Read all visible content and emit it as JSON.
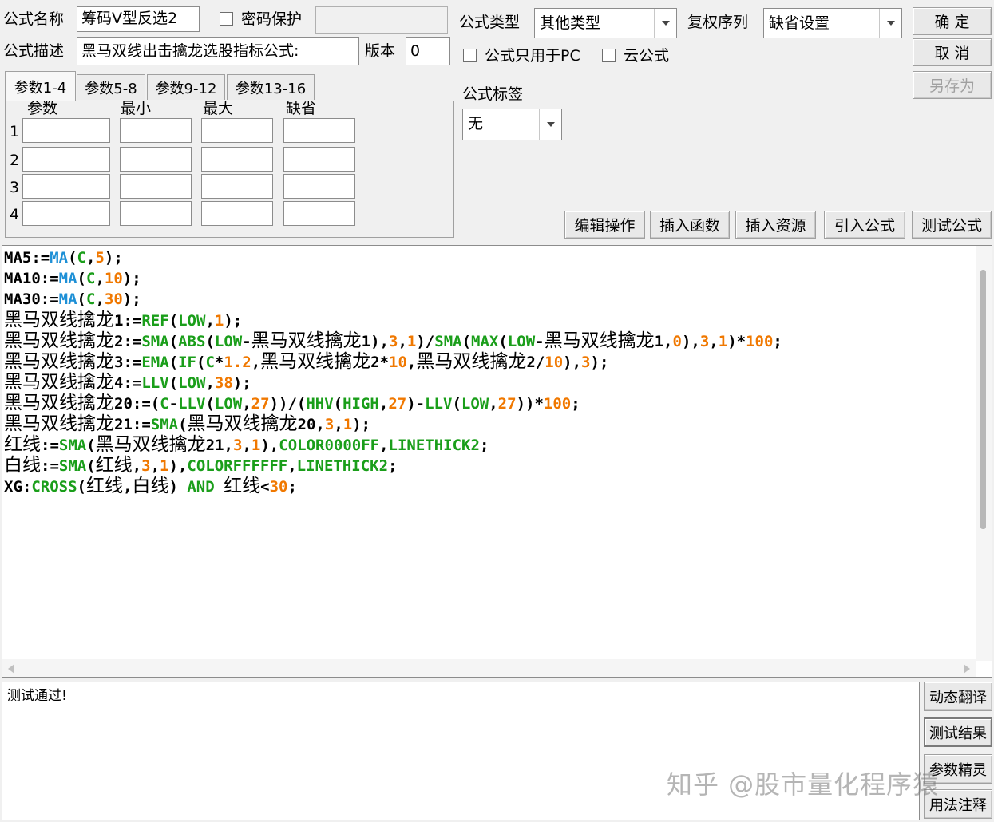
{
  "form": {
    "name_label": "公式名称",
    "name_value": "筹码V型反选2",
    "password_label": "密码保护",
    "password_value": "",
    "desc_label": "公式描述",
    "desc_value": "黑马双线出击擒龙选股指标公式:",
    "version_label": "版本",
    "version_value": "0",
    "type_label": "公式类型",
    "type_value": "其他类型",
    "rights_label": "复权序列",
    "rights_value": "缺省设置",
    "pc_only_label": "公式只用于PC",
    "cloud_label": "云公式",
    "tag_label": "公式标签",
    "tag_value": "无"
  },
  "buttons": {
    "ok": "确  定",
    "cancel": "取  消",
    "save_as": "另存为",
    "edit_ops": "编辑操作",
    "insert_func": "插入函数",
    "insert_res": "插入资源",
    "import_formula": "引入公式",
    "test_formula": "测试公式",
    "dyn_translate": "动态翻译",
    "test_result": "测试结果",
    "param_wizard": "参数精灵",
    "usage_note": "用法注释"
  },
  "tabs": [
    "参数1-4",
    "参数5-8",
    "参数9-12",
    "参数13-16"
  ],
  "params": {
    "headers": [
      "参数",
      "最小",
      "最大",
      "缺省"
    ],
    "rows": [
      "1",
      "2",
      "3",
      "4"
    ]
  },
  "code_lines": [
    [
      [
        "MA5:=",
        "k"
      ],
      [
        "MA",
        "b"
      ],
      [
        "(",
        "k"
      ],
      [
        "C",
        "g"
      ],
      [
        ",",
        "k"
      ],
      [
        "5",
        "o"
      ],
      [
        ");",
        "k"
      ]
    ],
    [
      [
        "MA10:=",
        "k"
      ],
      [
        "MA",
        "b"
      ],
      [
        "(",
        "k"
      ],
      [
        "C",
        "g"
      ],
      [
        ",",
        "k"
      ],
      [
        "10",
        "o"
      ],
      [
        ");",
        "k"
      ]
    ],
    [
      [
        "MA30:=",
        "k"
      ],
      [
        "MA",
        "b"
      ],
      [
        "(",
        "k"
      ],
      [
        "C",
        "g"
      ],
      [
        ",",
        "k"
      ],
      [
        "30",
        "o"
      ],
      [
        ");",
        "k"
      ]
    ],
    [
      [
        "黑马双线擒龙",
        "kc"
      ],
      [
        "1:=",
        "k"
      ],
      [
        "REF",
        "g"
      ],
      [
        "(",
        "k"
      ],
      [
        "LOW",
        "g"
      ],
      [
        ",",
        "k"
      ],
      [
        "1",
        "o"
      ],
      [
        ");",
        "k"
      ]
    ],
    [
      [
        "黑马双线擒龙",
        "kc"
      ],
      [
        "2:=",
        "k"
      ],
      [
        "SMA",
        "g"
      ],
      [
        "(",
        "k"
      ],
      [
        "ABS",
        "g"
      ],
      [
        "(",
        "k"
      ],
      [
        "LOW",
        "g"
      ],
      [
        "-",
        "k"
      ],
      [
        "黑马双线擒龙",
        "kc"
      ],
      [
        "1),",
        "k"
      ],
      [
        "3",
        "o"
      ],
      [
        ",",
        "k"
      ],
      [
        "1",
        "o"
      ],
      [
        ")/",
        "k"
      ],
      [
        "SMA",
        "g"
      ],
      [
        "(",
        "k"
      ],
      [
        "MAX",
        "g"
      ],
      [
        "(",
        "k"
      ],
      [
        "LOW",
        "g"
      ],
      [
        "-",
        "k"
      ],
      [
        "黑马双线擒龙",
        "kc"
      ],
      [
        "1,",
        "k"
      ],
      [
        "0",
        "o"
      ],
      [
        "),",
        "k"
      ],
      [
        "3",
        "o"
      ],
      [
        ",",
        "k"
      ],
      [
        "1",
        "o"
      ],
      [
        ")*",
        "k"
      ],
      [
        "100",
        "o"
      ],
      [
        ";",
        "k"
      ]
    ],
    [
      [
        "黑马双线擒龙",
        "kc"
      ],
      [
        "3:=",
        "k"
      ],
      [
        "EMA",
        "g"
      ],
      [
        "(",
        "k"
      ],
      [
        "IF",
        "g"
      ],
      [
        "(",
        "k"
      ],
      [
        "C",
        "g"
      ],
      [
        "*",
        "k"
      ],
      [
        "1.2",
        "o"
      ],
      [
        ",",
        "k"
      ],
      [
        "黑马双线擒龙",
        "kc"
      ],
      [
        "2*",
        "k"
      ],
      [
        "10",
        "o"
      ],
      [
        ",",
        "k"
      ],
      [
        "黑马双线擒龙",
        "kc"
      ],
      [
        "2/",
        "k"
      ],
      [
        "10",
        "o"
      ],
      [
        "),",
        "k"
      ],
      [
        "3",
        "o"
      ],
      [
        ");",
        "k"
      ]
    ],
    [
      [
        "黑马双线擒龙",
        "kc"
      ],
      [
        "4:=",
        "k"
      ],
      [
        "LLV",
        "g"
      ],
      [
        "(",
        "k"
      ],
      [
        "LOW",
        "g"
      ],
      [
        ",",
        "k"
      ],
      [
        "38",
        "o"
      ],
      [
        ");",
        "k"
      ]
    ],
    [
      [
        "黑马双线擒龙",
        "kc"
      ],
      [
        "20:=(",
        "k"
      ],
      [
        "C",
        "g"
      ],
      [
        "-",
        "k"
      ],
      [
        "LLV",
        "g"
      ],
      [
        "(",
        "k"
      ],
      [
        "LOW",
        "g"
      ],
      [
        ",",
        "k"
      ],
      [
        "27",
        "o"
      ],
      [
        "))/(",
        "k"
      ],
      [
        "HHV",
        "g"
      ],
      [
        "(",
        "k"
      ],
      [
        "HIGH",
        "g"
      ],
      [
        ",",
        "k"
      ],
      [
        "27",
        "o"
      ],
      [
        ")-",
        "k"
      ],
      [
        "LLV",
        "g"
      ],
      [
        "(",
        "k"
      ],
      [
        "LOW",
        "g"
      ],
      [
        ",",
        "k"
      ],
      [
        "27",
        "o"
      ],
      [
        "))*",
        "k"
      ],
      [
        "100",
        "o"
      ],
      [
        ";",
        "k"
      ]
    ],
    [
      [
        "黑马双线擒龙",
        "kc"
      ],
      [
        "21:=",
        "k"
      ],
      [
        "SMA",
        "g"
      ],
      [
        "(",
        "k"
      ],
      [
        "黑马双线擒龙",
        "kc"
      ],
      [
        "20,",
        "k"
      ],
      [
        "3",
        "o"
      ],
      [
        ",",
        "k"
      ],
      [
        "1",
        "o"
      ],
      [
        ");",
        "k"
      ]
    ],
    [
      [
        "红线",
        "kc"
      ],
      [
        ":=",
        "k"
      ],
      [
        "SMA",
        "g"
      ],
      [
        "(",
        "k"
      ],
      [
        "黑马双线擒龙",
        "kc"
      ],
      [
        "21,",
        "k"
      ],
      [
        "3",
        "o"
      ],
      [
        ",",
        "k"
      ],
      [
        "1",
        "o"
      ],
      [
        "),",
        "k"
      ],
      [
        "COLOR0000FF",
        "g"
      ],
      [
        ",",
        "k"
      ],
      [
        "LINETHICK2",
        "g"
      ],
      [
        ";",
        "k"
      ]
    ],
    [
      [
        "白线",
        "kc"
      ],
      [
        ":=",
        "k"
      ],
      [
        "SMA",
        "g"
      ],
      [
        "(",
        "k"
      ],
      [
        "红线",
        "kc"
      ],
      [
        ",",
        "k"
      ],
      [
        "3",
        "o"
      ],
      [
        ",",
        "k"
      ],
      [
        "1",
        "o"
      ],
      [
        "),",
        "k"
      ],
      [
        "COLORFFFFFF",
        "g"
      ],
      [
        ",",
        "k"
      ],
      [
        "LINETHICK2",
        "g"
      ],
      [
        ";",
        "k"
      ]
    ],
    [
      [
        "XG:",
        "k"
      ],
      [
        "CROSS",
        "g"
      ],
      [
        "(",
        "k"
      ],
      [
        "红线",
        "kc"
      ],
      [
        ",",
        "k"
      ],
      [
        "白线",
        "kc"
      ],
      [
        ") ",
        "k"
      ],
      [
        "AND",
        "g"
      ],
      [
        " ",
        "k"
      ],
      [
        "红线",
        "kc"
      ],
      [
        "<",
        "k"
      ],
      [
        "30",
        "o"
      ],
      [
        ";",
        "k"
      ]
    ]
  ],
  "colors": {
    "k": "#000000",
    "b": "#1e90d6",
    "g": "#1a9e1a",
    "o": "#f07800"
  },
  "output_text": "测试通过!",
  "watermark": "知乎 @股市量化程序猿"
}
